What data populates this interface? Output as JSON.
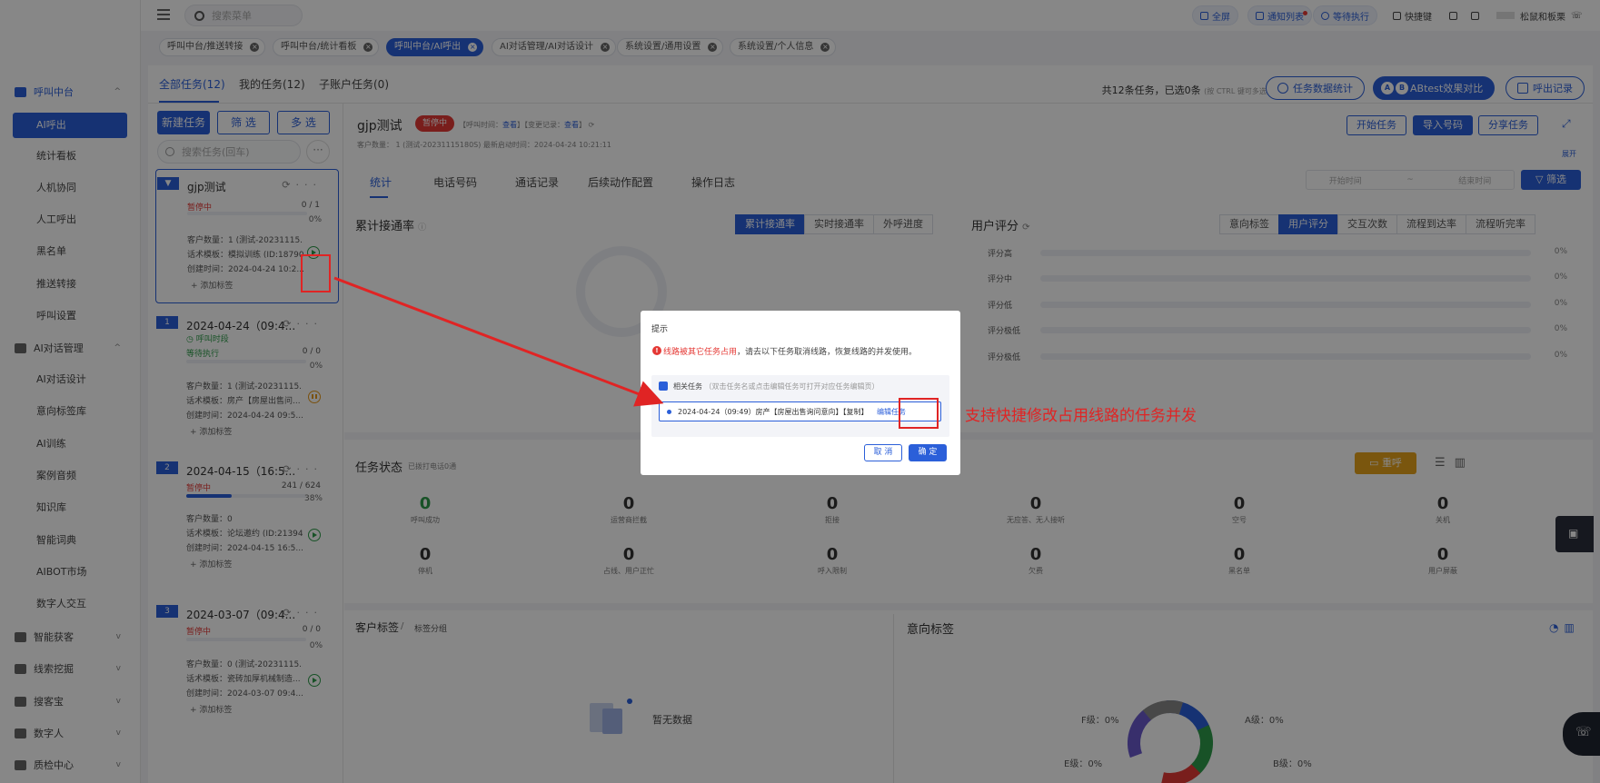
{
  "sidebar": {
    "groups": [
      {
        "label": "呼叫中台",
        "expanded": true
      },
      {
        "label": "AI对话管理",
        "expanded": true
      },
      {
        "label": "智能获客"
      },
      {
        "label": "线索挖掘"
      },
      {
        "label": "搜客宝"
      },
      {
        "label": "数字人"
      },
      {
        "label": "质检中心"
      }
    ],
    "items": [
      "AI呼出",
      "统计看板",
      "人机协同",
      "人工呼出",
      "黑名单",
      "推送转接",
      "呼叫设置",
      "AI对话设计",
      "意向标签库",
      "AI训练",
      "案例音频",
      "知识库",
      "智能词典",
      "AIBOT市场",
      "数字人交互"
    ]
  },
  "topbar": {
    "search_placeholder": "搜索菜单",
    "fullscreen": "全屏",
    "notify": "通知列表",
    "waiting": "等待执行",
    "shortcut": "快捷键",
    "user": "松鼠和板栗"
  },
  "tabs": [
    "呼叫中台/推送转接",
    "呼叫中台/统计看板",
    "呼叫中台/AI呼出",
    "AI对话管理/AI对话设计",
    "系统设置/通用设置",
    "系统设置/个人信息"
  ],
  "subtabs": [
    "全部任务(12)",
    "我的任务(12)",
    "子账户任务(0)"
  ],
  "summary": {
    "text": "共12条任务，已选0条",
    "hint": "(按 CTRL 键可多选)"
  },
  "top_buttons": {
    "stats": "任务数据统计",
    "ab_badge_a": "A",
    "ab_badge_b": "B",
    "ab": "ABtest效果对比",
    "records": "呼出记录"
  },
  "task_list": {
    "new_btn": "新建任务",
    "filter_btn": "筛 选",
    "multi_btn": "多 选",
    "search_placeholder": "搜索任务(回车)",
    "more": "···",
    "add_tag": "+ 添加标签",
    "cards": [
      {
        "idx": "",
        "title": "gjp测试",
        "status": "暂停中",
        "count": "0 / 1",
        "pct": "0%",
        "progress": 0,
        "data": "1 (测试-20231115...",
        "template": "模拟训练 (ID:18790",
        "created": "2024-04-24 10:2..."
      },
      {
        "idx": "1",
        "title": "2024-04-24（09:4...",
        "status": "呼叫时段",
        "status2": "等待执行",
        "count": "0 / 0",
        "pct": "0%",
        "progress": 0,
        "data": "1 (测试-20231115...",
        "template": "房产【房屋出售问...",
        "created": "2024-04-24 09:5..."
      },
      {
        "idx": "2",
        "title": "2024-04-15（16:5...",
        "status": "暂停中",
        "count": "241 / 624",
        "pct": "38%",
        "progress": 38,
        "data": "0",
        "template": "论坛邀约 (ID:21394)",
        "created": "2024-04-15 16:5..."
      },
      {
        "idx": "3",
        "title": "2024-03-07（09:4...",
        "status": "暂停中",
        "count": "0 / 0",
        "pct": "0%",
        "progress": 0,
        "data": "0 (测试-20231115...",
        "template": "瓷砖加厚机械制造...",
        "created": "2024-03-07 09:4..."
      }
    ],
    "meta_labels": {
      "data": "客户数量：",
      "template": "话术模板：",
      "created": "创建时间："
    }
  },
  "detail": {
    "title": "gjp测试",
    "badge": "暂停中",
    "meta_call_time": "【呼叫时间：",
    "meta_view": "查看",
    "meta_change": "】【变更记录：",
    "meta_view2": "查看",
    "meta_end": "】",
    "sub_meta": "客户数量： 1 (测试-20231115180S)     最新启动时间：2024-04-24 10:21:11",
    "buttons": [
      "开始任务",
      "导入号码",
      "分享任务"
    ],
    "expand": "展开",
    "tabs": [
      "统计",
      "电话号码",
      "通话记录",
      "后续动作配置",
      "操作日志"
    ],
    "date_start": "开始时间",
    "date_sep": "~",
    "date_end": "结束时间",
    "filter": "筛选",
    "rate_title": "累计接通率",
    "rate_segs": [
      "累计接通率",
      "实时接通率",
      "外呼进度"
    ],
    "score_title": "用户评分",
    "score_segs": [
      "意向标签",
      "用户评分",
      "交互次数",
      "流程到达率",
      "流程听完率"
    ],
    "score_rows": [
      {
        "label": "评分高",
        "value": "0%"
      },
      {
        "label": "评分中",
        "value": "0%"
      },
      {
        "label": "评分低",
        "value": "0%"
      },
      {
        "label": "评分极低",
        "value": "0%"
      },
      {
        "label": "评分极低",
        "value": "0%"
      }
    ],
    "status_title": "任务状态",
    "status_sub": "已拨打电话0通",
    "reset": "重呼",
    "stats": [
      {
        "num": "0",
        "label": "呼叫成功"
      },
      {
        "num": "0",
        "label": "运营商拦截"
      },
      {
        "num": "0",
        "label": "拒接"
      },
      {
        "num": "0",
        "label": "无应答、无人接听"
      },
      {
        "num": "0",
        "label": "空号"
      },
      {
        "num": "0",
        "label": "关机"
      },
      {
        "num": "0",
        "label": "停机"
      },
      {
        "num": "0",
        "label": "占线、用户正忙"
      },
      {
        "num": "0",
        "label": "呼入限制"
      },
      {
        "num": "0",
        "label": "欠费"
      },
      {
        "num": "0",
        "label": "黑名单"
      },
      {
        "num": "0",
        "label": "用户屏蔽"
      }
    ],
    "tag_title": "客户标签",
    "tag_sep": "/",
    "tag_sub": "标签分组",
    "no_data": "暂无数据",
    "intent_title": "意向标签",
    "donut": {
      "f": "F级：0%",
      "a": "A级：0%",
      "e": "E级：0%",
      "b": "B级：0%"
    }
  },
  "dialog": {
    "title": "提示",
    "err_icon": "!",
    "msg_red": "线路被其它任务占用",
    "msg_rest": "，请去以下任务取消线路，恢复线路的并发使用。",
    "box_label": "相关任务",
    "box_hint": "（双击任务名或点击编辑任务可打开对应任务编辑页）",
    "task": "2024-04-24（09:49）房产【房屋出售询问意向】【复制】",
    "edit": "编辑任务",
    "cancel": "取 消",
    "ok": "确 定"
  },
  "annotation": "支持快捷修改占用线路的任务并发",
  "colors": {
    "primary": "#2b5fd9",
    "danger": "#e53935",
    "success": "#2e9c4a",
    "warning": "#e6a21c",
    "annotation": "#e02424"
  }
}
